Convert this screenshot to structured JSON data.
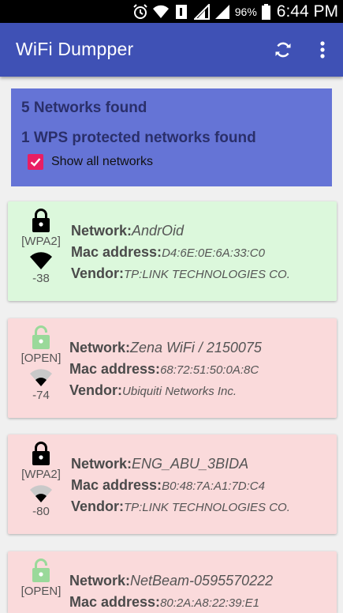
{
  "status_bar": {
    "battery": "96%",
    "time": "6:44 PM",
    "icons": [
      "alarm-icon",
      "wifi-status-icon",
      "sim1-icon",
      "signal-icon",
      "signal-icon",
      "battery-icon"
    ]
  },
  "app_bar": {
    "title": "WiFi Dumpper",
    "actions": [
      "refresh-icon",
      "more-vert-icon"
    ],
    "color": "#3f51b5"
  },
  "summary": {
    "networks_found": "5 Networks found",
    "wps_found": "1 WPS protected networks found",
    "show_all_label": "Show all networks",
    "show_all_checked": true
  },
  "labels": {
    "network": "Network:",
    "mac": "Mac address:",
    "vendor": "Vendor:"
  },
  "networks": [
    {
      "ssid": "AndrOid",
      "mac": "D4:6E:0E:6A:33:C0",
      "vendor": "TP:LINK TECHNOLOGIES CO.",
      "security": "[WPA2]",
      "signal": "-38",
      "locked": true,
      "wps": true,
      "bg": "#dcf8dc"
    },
    {
      "ssid": "Zena WiFi / 2150075",
      "mac": "68:72:51:50:0A:8C",
      "vendor": "Ubiquiti Networks Inc.",
      "security": "[OPEN]",
      "signal": "-74",
      "locked": false,
      "wps": false,
      "bg": "#fadadb"
    },
    {
      "ssid": "ENG_ABU_3BIDA",
      "mac": "B0:48:7A:A1:7D:C4",
      "vendor": "TP:LINK TECHNOLOGIES CO.",
      "security": "[WPA2]",
      "signal": "-80",
      "locked": true,
      "wps": false,
      "bg": "#fadadb"
    },
    {
      "ssid": "NetBeam-0595570222",
      "mac": "80:2A:A8:22:39:E1",
      "vendor": "",
      "security": "[OPEN]",
      "signal": "",
      "locked": false,
      "wps": false,
      "bg": "#fadadb"
    }
  ]
}
